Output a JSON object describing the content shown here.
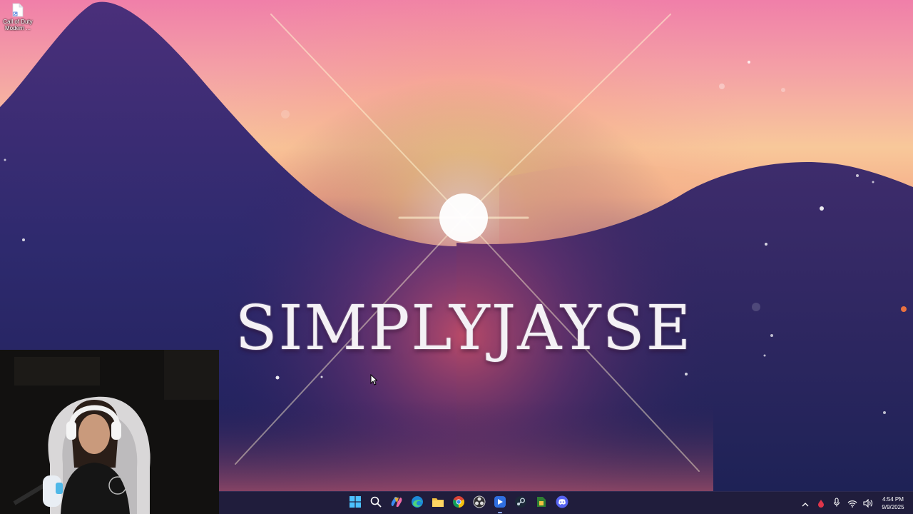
{
  "desktop": {
    "icons": [
      {
        "label": "Call of Duty Modern ...",
        "icon": "file-shortcut-icon"
      }
    ],
    "wallpaper_title": "SIMPLYJAYSE"
  },
  "taskbar": {
    "apps": [
      {
        "name": "start",
        "icon": "windows-start-icon"
      },
      {
        "name": "search",
        "icon": "search-icon"
      },
      {
        "name": "copilot",
        "icon": "copilot-icon"
      },
      {
        "name": "edge",
        "icon": "edge-icon"
      },
      {
        "name": "file-explorer",
        "icon": "folder-icon"
      },
      {
        "name": "chrome",
        "icon": "chrome-icon"
      },
      {
        "name": "obs",
        "icon": "obs-icon"
      },
      {
        "name": "streamer-app",
        "icon": "streamer-app-icon"
      },
      {
        "name": "steam",
        "icon": "steam-icon"
      },
      {
        "name": "tool-app",
        "icon": "tool-app-icon"
      },
      {
        "name": "discord",
        "icon": "discord-icon"
      }
    ],
    "tray": {
      "icons": [
        "chevron-up-icon",
        "red-app-icon",
        "microphone-icon",
        "wifi-icon",
        "volume-icon"
      ],
      "time": "4:54 PM",
      "date": "9/9/2025"
    }
  },
  "colors": {
    "taskbar_bg": "#201d3c",
    "accent": "#8aa8ff",
    "title_text": "#f4f1f5"
  }
}
